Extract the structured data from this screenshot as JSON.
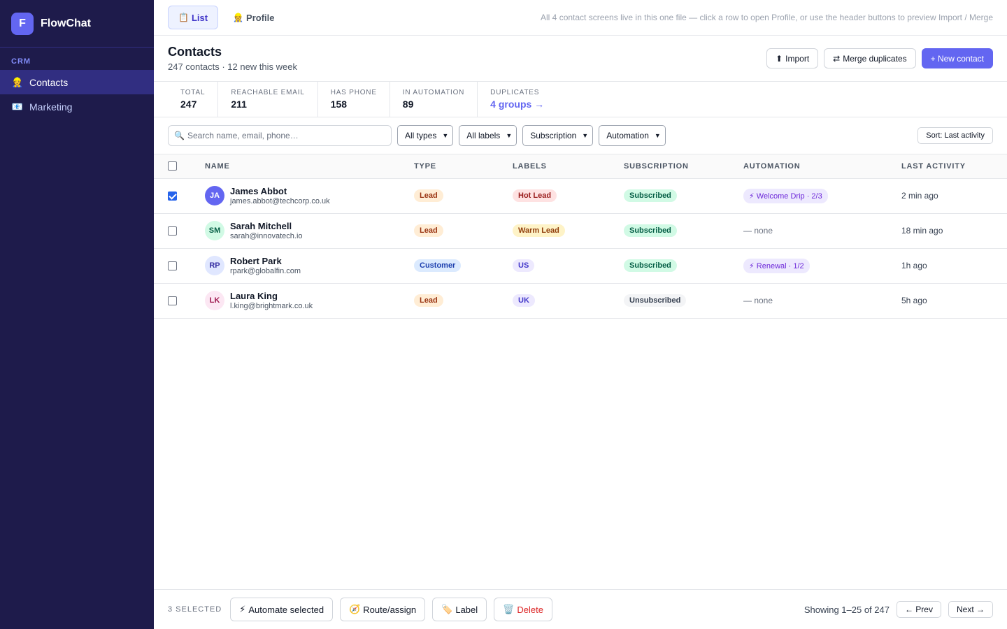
{
  "app": {
    "logo_letter": "F",
    "name": "FlowChat"
  },
  "sidebar": {
    "section": "CRM",
    "items": [
      {
        "label": "Contacts",
        "icon": "👷",
        "active": true
      },
      {
        "label": "Marketing",
        "icon": "📧",
        "active": false
      }
    ]
  },
  "topbar": {
    "tabs": [
      {
        "label": "List",
        "icon": "📋",
        "active": true
      },
      {
        "label": "Profile",
        "icon": "👷",
        "active": false
      }
    ],
    "hint": "All 4 contact screens live in this one file — click a row to open Profile, or use the header buttons to preview Import / Merge"
  },
  "header": {
    "title": "Contacts",
    "subtitle": "247 contacts · 12 new this week",
    "import_label": "Import",
    "import_icon": "⬆",
    "merge_label": "Merge duplicates",
    "merge_icon": "⇄",
    "new_label": "+ New contact"
  },
  "stats": [
    {
      "label": "TOTAL",
      "value": "247"
    },
    {
      "label": "REACHABLE EMAIL",
      "value": "211"
    },
    {
      "label": "HAS PHONE",
      "value": "158"
    },
    {
      "label": "IN AUTOMATION",
      "value": "89"
    },
    {
      "label": "DUPLICATES",
      "value": "4 groups →",
      "link": true
    }
  ],
  "filters": {
    "search_placeholder": "Search name, email, phone…",
    "search_icon": "🔍",
    "selects": [
      "All types",
      "All labels",
      "Subscription",
      "Automation"
    ],
    "sort_label": "Sort: Last activity"
  },
  "table": {
    "columns": [
      "NAME",
      "TYPE",
      "LABELS",
      "SUBSCRIPTION",
      "AUTOMATION",
      "LAST ACTIVITY"
    ],
    "rows": [
      {
        "checked": true,
        "initials": "JA",
        "avatar_bg": "#6366f1",
        "avatar_fg": "#ffffff",
        "name": "James Abbot",
        "email": "james.abbot@techcorp.co.uk",
        "type": "Lead",
        "type_bg": "#ffedd5",
        "type_fg": "#9a3412",
        "label": "Hot Lead",
        "label_bg": "#fee2e2",
        "label_fg": "#991b1b",
        "subscription": "Subscribed",
        "sub_bg": "#d1fae5",
        "sub_fg": "#065f46",
        "automation": "⚡ Welcome Drip · 2/3",
        "has_automation": true,
        "activity": "2 min ago"
      },
      {
        "checked": false,
        "initials": "SM",
        "avatar_bg": "#d1fae5",
        "avatar_fg": "#065f46",
        "name": "Sarah Mitchell",
        "email": "sarah@innovatech.io",
        "type": "Lead",
        "type_bg": "#ffedd5",
        "type_fg": "#9a3412",
        "label": "Warm Lead",
        "label_bg": "#fef3c7",
        "label_fg": "#92400e",
        "subscription": "Subscribed",
        "sub_bg": "#d1fae5",
        "sub_fg": "#065f46",
        "automation": "— none",
        "has_automation": false,
        "activity": "18 min ago"
      },
      {
        "checked": false,
        "initials": "RP",
        "avatar_bg": "#e0e7ff",
        "avatar_fg": "#3730a3",
        "name": "Robert Park",
        "email": "rpark@globalfin.com",
        "type": "Customer",
        "type_bg": "#dbeafe",
        "type_fg": "#1e40af",
        "label": "US",
        "label_bg": "#ede9fe",
        "label_fg": "#4338ca",
        "subscription": "Subscribed",
        "sub_bg": "#d1fae5",
        "sub_fg": "#065f46",
        "automation": "⚡ Renewal · 1/2",
        "has_automation": true,
        "activity": "1h ago"
      },
      {
        "checked": false,
        "initials": "LK",
        "avatar_bg": "#fce7f3",
        "avatar_fg": "#9d174d",
        "name": "Laura King",
        "email": "l.king@brightmark.co.uk",
        "type": "Lead",
        "type_bg": "#ffedd5",
        "type_fg": "#9a3412",
        "label": "UK",
        "label_bg": "#ede9fe",
        "label_fg": "#4338ca",
        "subscription": "Unsubscribed",
        "sub_bg": "#f3f4f6",
        "sub_fg": "#374151",
        "automation": "— none",
        "has_automation": false,
        "activity": "5h ago"
      }
    ]
  },
  "footer": {
    "selected": "3 SELECTED",
    "actions": [
      {
        "label": "Automate selected",
        "icon": "⚡",
        "danger": false
      },
      {
        "label": "Route/assign",
        "icon": "🧭",
        "danger": false
      },
      {
        "label": "Label",
        "icon": "🏷️",
        "danger": false
      },
      {
        "label": "Delete",
        "icon": "🗑️",
        "danger": true
      }
    ],
    "pager_text": "Showing 1–25 of 247",
    "prev_label": "← Prev",
    "next_label": "Next →"
  }
}
